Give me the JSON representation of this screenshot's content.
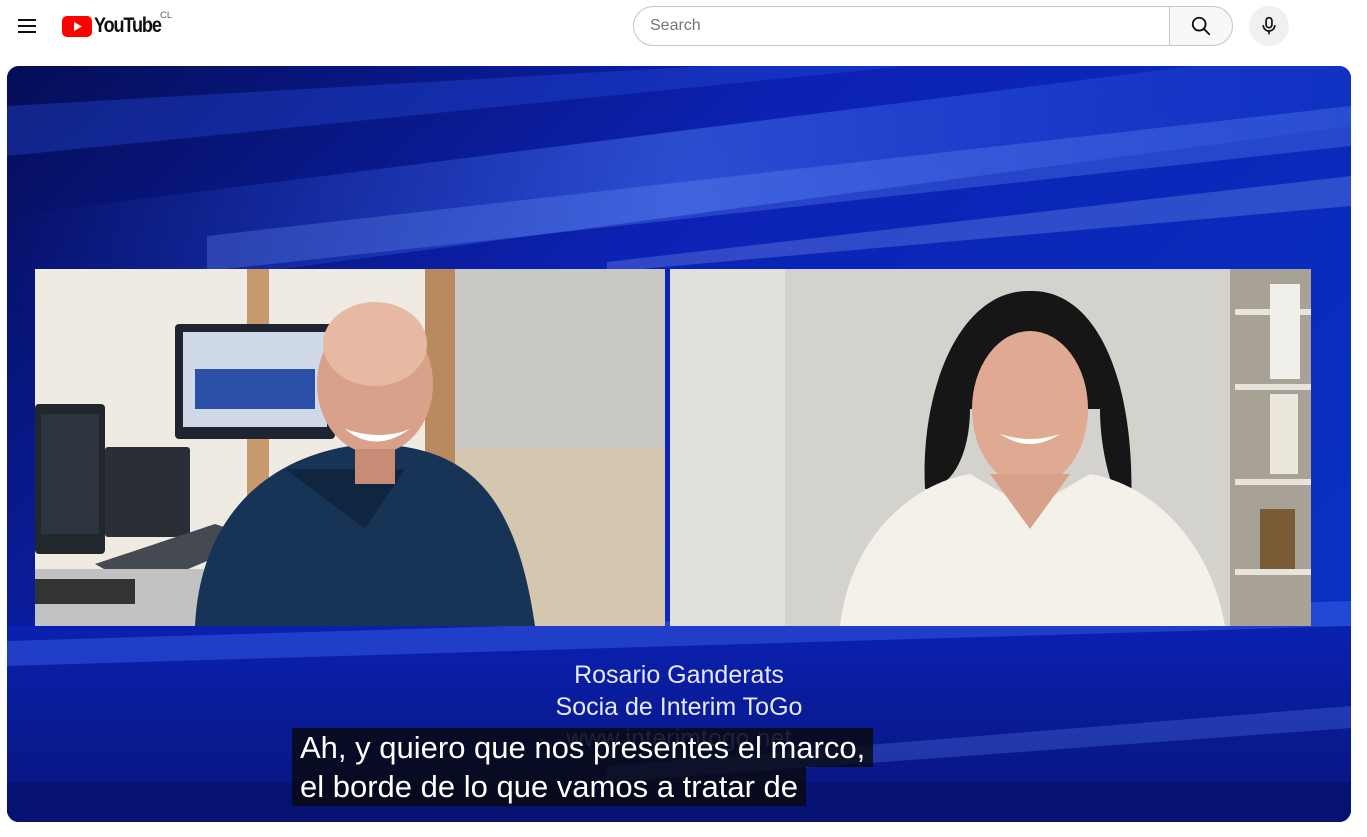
{
  "masthead": {
    "logo_text": "YouTube",
    "country_code": "CL",
    "search": {
      "placeholder": "Search",
      "value": ""
    }
  },
  "video": {
    "overlay": {
      "name": "Rosario Ganderats",
      "role": "Socia de Interim ToGo",
      "website": "www.interimtogo.net"
    },
    "captions": [
      "Ah, y quiero que nos presentes el marco,",
      "el borde de lo que vamos a tratar de"
    ]
  },
  "colors": {
    "brand_red": "#ff0000",
    "background_blue": "#0a1a8a"
  },
  "icons": [
    "menu-icon",
    "youtube-play-icon",
    "search-icon",
    "mic-icon"
  ]
}
